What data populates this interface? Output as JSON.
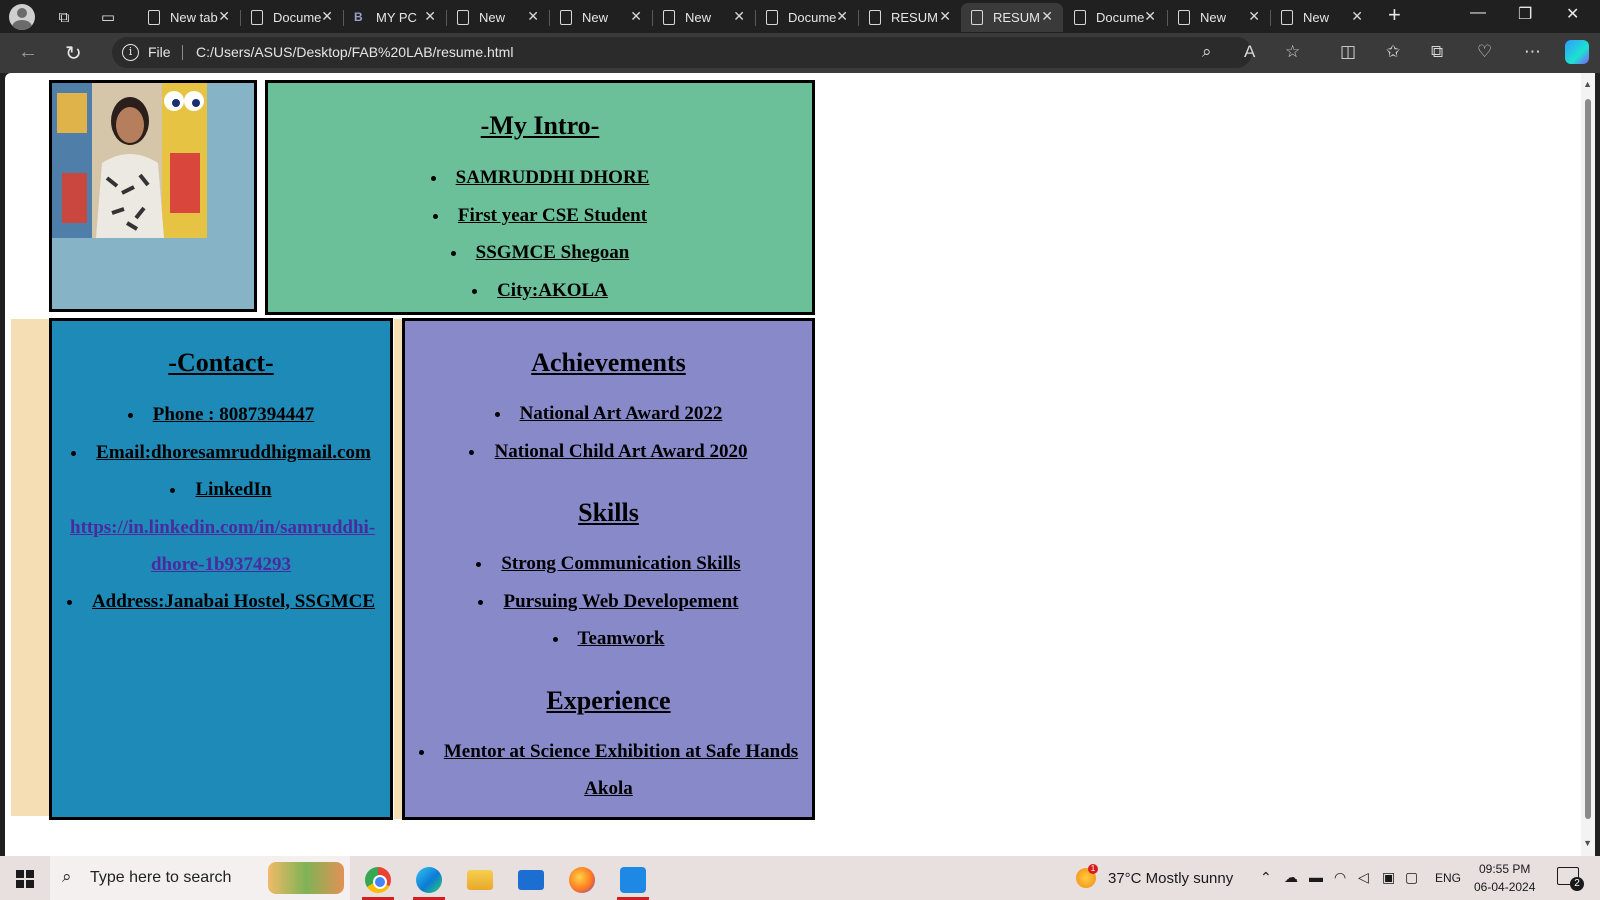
{
  "browser": {
    "tabs": [
      {
        "label": "New tab",
        "icon": "newtab-icon"
      },
      {
        "label": "Document",
        "icon": "document-icon"
      },
      {
        "label": "MY PC",
        "icon": "bing-icon"
      },
      {
        "label": "New",
        "icon": "document-icon"
      },
      {
        "label": "New",
        "icon": "document-icon"
      },
      {
        "label": "New",
        "icon": "document-icon"
      },
      {
        "label": "Document",
        "icon": "document-icon"
      },
      {
        "label": "RESUME",
        "icon": "document-icon"
      },
      {
        "label": "RESUME",
        "icon": "document-icon",
        "active": true
      },
      {
        "label": "Document",
        "icon": "document-icon"
      },
      {
        "label": "New",
        "icon": "document-icon"
      },
      {
        "label": "New",
        "icon": "document-icon"
      }
    ],
    "address": {
      "scheme_label": "File",
      "url": "C:/Users/ASUS/Desktop/FAB%20LAB/resume.html"
    }
  },
  "page": {
    "intro": {
      "title": "-My Intro-",
      "items": [
        "SAMRUDDHI DHORE",
        "First year CSE Student",
        "SSGMCE Shegoan",
        "City:AKOLA"
      ]
    },
    "contact": {
      "title": "-Contact-",
      "phone": "Phone : 8087394447",
      "email": "Email:dhoresamruddhigmail.com",
      "linkedin_label": "LinkedIn",
      "linkedin_url_line1": "https://in.linkedin.com/in/samruddhi-",
      "linkedin_url_line2": "dhore-1b9374293",
      "address": "Address:Janabai Hostel, SSGMCE"
    },
    "achievements": {
      "title": "Achievements",
      "items": [
        "National Art Award 2022",
        "National Child Art Award 2020"
      ]
    },
    "skills": {
      "title": "Skills",
      "items": [
        "Strong Communication Skills",
        "Pursuing Web Developement",
        "Teamwork"
      ]
    },
    "experience": {
      "title": "Experience",
      "items_line1": "Mentor at Science Exhibition at Safe Hands",
      "items_line2": "Akola"
    }
  },
  "taskbar": {
    "search_placeholder": "Type here to search",
    "weather": "37°C  Mostly sunny",
    "weather_badge": "1",
    "language": "ENG",
    "time": "09:55 PM",
    "date": "06-04-2024",
    "notification_count": "2",
    "apps": [
      "chrome-icon",
      "edge-icon",
      "file-explorer-icon",
      "mail-icon",
      "firefox-icon",
      "vscode-icon"
    ]
  }
}
